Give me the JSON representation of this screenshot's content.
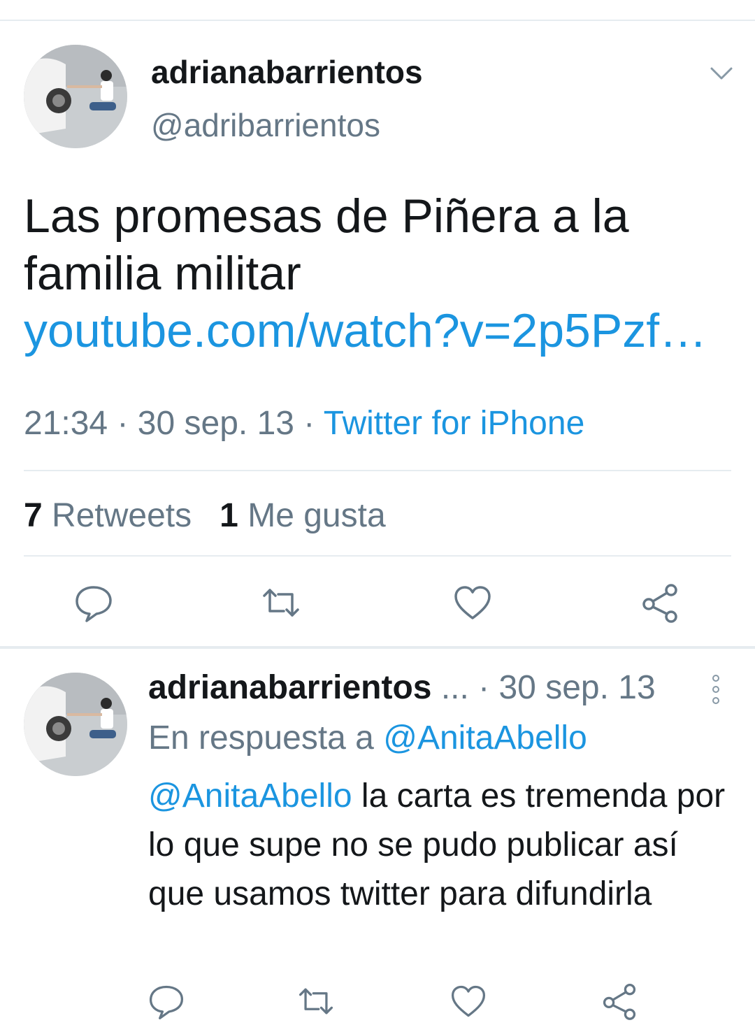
{
  "tweet": {
    "author_name": "adrianabarrientos",
    "author_handle": "@adribarrientos",
    "text": "Las promesas de Piñera a la familia militar ",
    "link_text": "youtube.com/watch?v=2p5Pzf…",
    "time": "21:34",
    "date": "30 sep. 13",
    "source": "Twitter for iPhone",
    "retweet_count": "7",
    "retweet_label": "Retweets",
    "like_count": "1",
    "like_label": "Me gusta"
  },
  "reply": {
    "author_name": "adrianabarrientos",
    "truncation": "...",
    "date": "30 sep. 13",
    "in_reply_prefix": "En respuesta a",
    "in_reply_handle": "@AnitaAbello",
    "mention": "@AnitaAbello",
    "text": " la carta es tremenda por lo que supe no se pudo publicar así que usamos twitter para difundirla"
  },
  "colors": {
    "link": "#1b95e0",
    "secondary": "#657786",
    "primary": "#14171a",
    "divider": "#e6ecf0"
  },
  "icons": [
    "chevron-down-icon",
    "reply-icon",
    "retweet-icon",
    "like-icon",
    "share-icon",
    "more-vertical-icon"
  ]
}
